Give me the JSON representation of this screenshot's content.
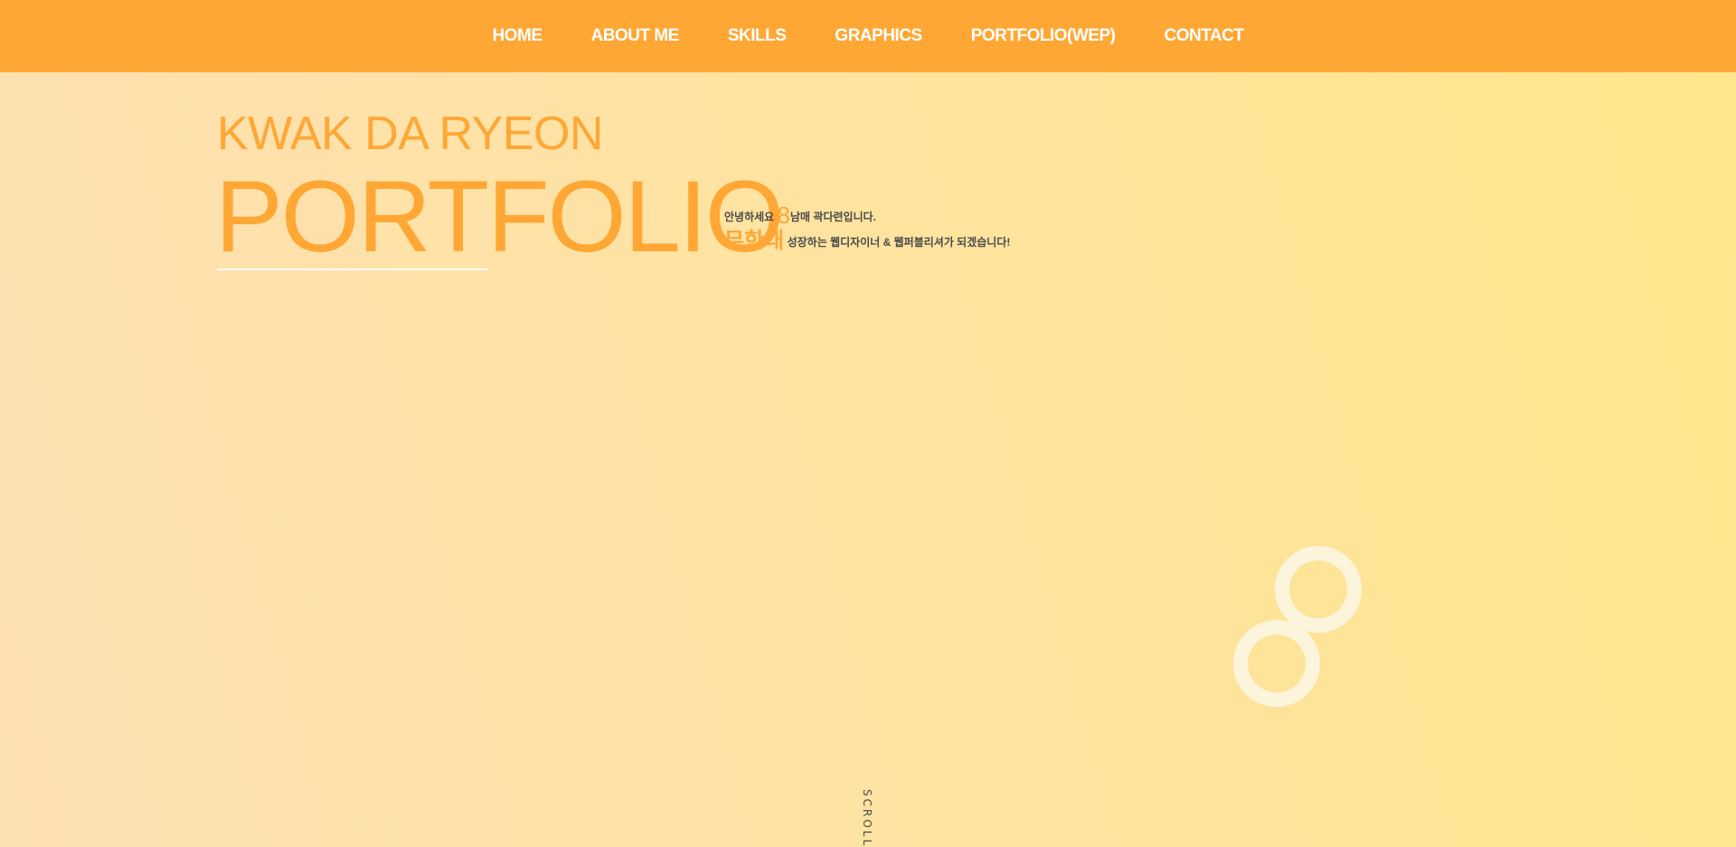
{
  "nav": {
    "items": [
      {
        "label": "HOME"
      },
      {
        "label": "ABOUT ME"
      },
      {
        "label": "SKILLS"
      },
      {
        "label": "GRAPHICS"
      },
      {
        "label": "PORTFOLIO(WEP)"
      },
      {
        "label": "CONTACT"
      }
    ]
  },
  "hero": {
    "name": "KWAK DA RYEON",
    "title": "PORTFOLIO",
    "intro": {
      "line1_prefix": "안녕하세요 ",
      "line1_number": "8",
      "line1_suffix": "남매 곽다련입니다.",
      "line2_emphasis": "무한대",
      "line2_text": " 성장하는 웹디자이너 & 웹퍼블리셔가 되겠습니다!"
    }
  },
  "scroll": {
    "label": "SCROLL"
  },
  "decor": {
    "icon": "infinity-eight-icon"
  },
  "colors": {
    "accent": "#ffa735",
    "nav_text": "#ffffff",
    "body_text": "#4a4a4a"
  }
}
